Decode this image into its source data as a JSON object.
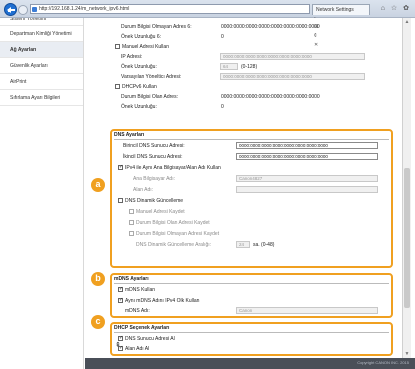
{
  "browser": {
    "address": "http://192.168.1.24/m_network_ipv6.html",
    "address_tools": "ρ - ☒ ¢ ✕",
    "tab_title": "Network Settings",
    "icons": "⌂ ☆ ✿"
  },
  "sidebar": {
    "items": [
      {
        "label": "Sistem Yönetimi"
      },
      {
        "label": "Departman Kimliği Yönetimi"
      },
      {
        "label": "Ağ Ayarları"
      },
      {
        "label": "Güvenlik Ayarları"
      },
      {
        "label": "AirPrint"
      },
      {
        "label": "Sıfırlama Ayarı Bilgileri"
      }
    ]
  },
  "ipv6": {
    "stateless_address_label": "Durum Bilgisi Olmayan Adres 6:",
    "stateless_address_value": "0000:0000:0000:0000:0000:0000:0000:0000",
    "prefix6_label": "Önek Uzunluğu 6:",
    "prefix6_value": "0",
    "manual_label": "Manuel Adresi Kullan",
    "ip_label": "IP Adresi:",
    "ip_value": "0000:0000:0000:0000:0000:0000:0000:0000",
    "prefix_label": "Önek Uzunluğu:",
    "prefix_value": "64",
    "prefix_range": "(0-128)",
    "gateway_label": "Varsayılan Yönelticı Adresi:",
    "gateway_value": "0000:0000:0000:0000:0000:0000:0000:0000",
    "dhcp_label": "DHCPv6 Kullan",
    "dhcp_address_label": "Durum Bilgisi Olan Adres:",
    "dhcp_address_value": "0000:0000:0000:0000:0000:0000:0000:0000",
    "dhcp_prefix_label": "Önek Uzunluğu:",
    "dhcp_prefix_value": "0"
  },
  "dns": {
    "title": "DNS Ayarları",
    "primary_label": "Birincil DNS Sunucu Adresi:",
    "primary_value": "0000:0000:0000:0000:0000:0000:0000:0000",
    "secondary_label": "İkincil DNS Sunucu Adresi:",
    "secondary_value": "0000:0000:0000:0000:0000:0000:0000:0000",
    "same_host_label": "IPv4 ile Aynı Ana Bilgisayar/Alan Adı Kullan",
    "host_label": "Ana Bilgisayar Adı:",
    "host_value": "Canon4827",
    "domain_label": "Alan Adı:",
    "domain_value": "",
    "dynamic_label": "DNS Dinamik Güncelleme",
    "manual_reg_label": "Manuel Adresi Kaydet",
    "stateful_reg_label": "Durum Bilgisi Olan Adresi Kaydet",
    "stateless_reg_label": "Durum Bilgisi Olmayan Adresi Kaydet",
    "interval_label": "DNS Dinamik Güncelleme Aralığı:",
    "interval_value": "24",
    "interval_unit": "sa. (0-48)"
  },
  "mdns": {
    "title": "mDNS Ayarları",
    "use_label": "mDNS Kullan",
    "same_name_label": "Aynı mDNS Adını IPv4 Olk Kullan",
    "name_label": "mDNS Adı:",
    "name_value": "Canon"
  },
  "dhcp": {
    "title": "DHCP Seçenek Ayarları",
    "dns_server_label": "DNS Sunucu Adresi Al",
    "domain_label": "Alan Adı Al"
  },
  "badges": {
    "a": "a",
    "b": "b",
    "c": "c"
  },
  "footer": {
    "top_arrow": "⇞",
    "copyright": "Copyright CANON INC. 2015"
  },
  "colors": {
    "accent": "#f0a020",
    "nav_blue": "#1f6fd1"
  }
}
